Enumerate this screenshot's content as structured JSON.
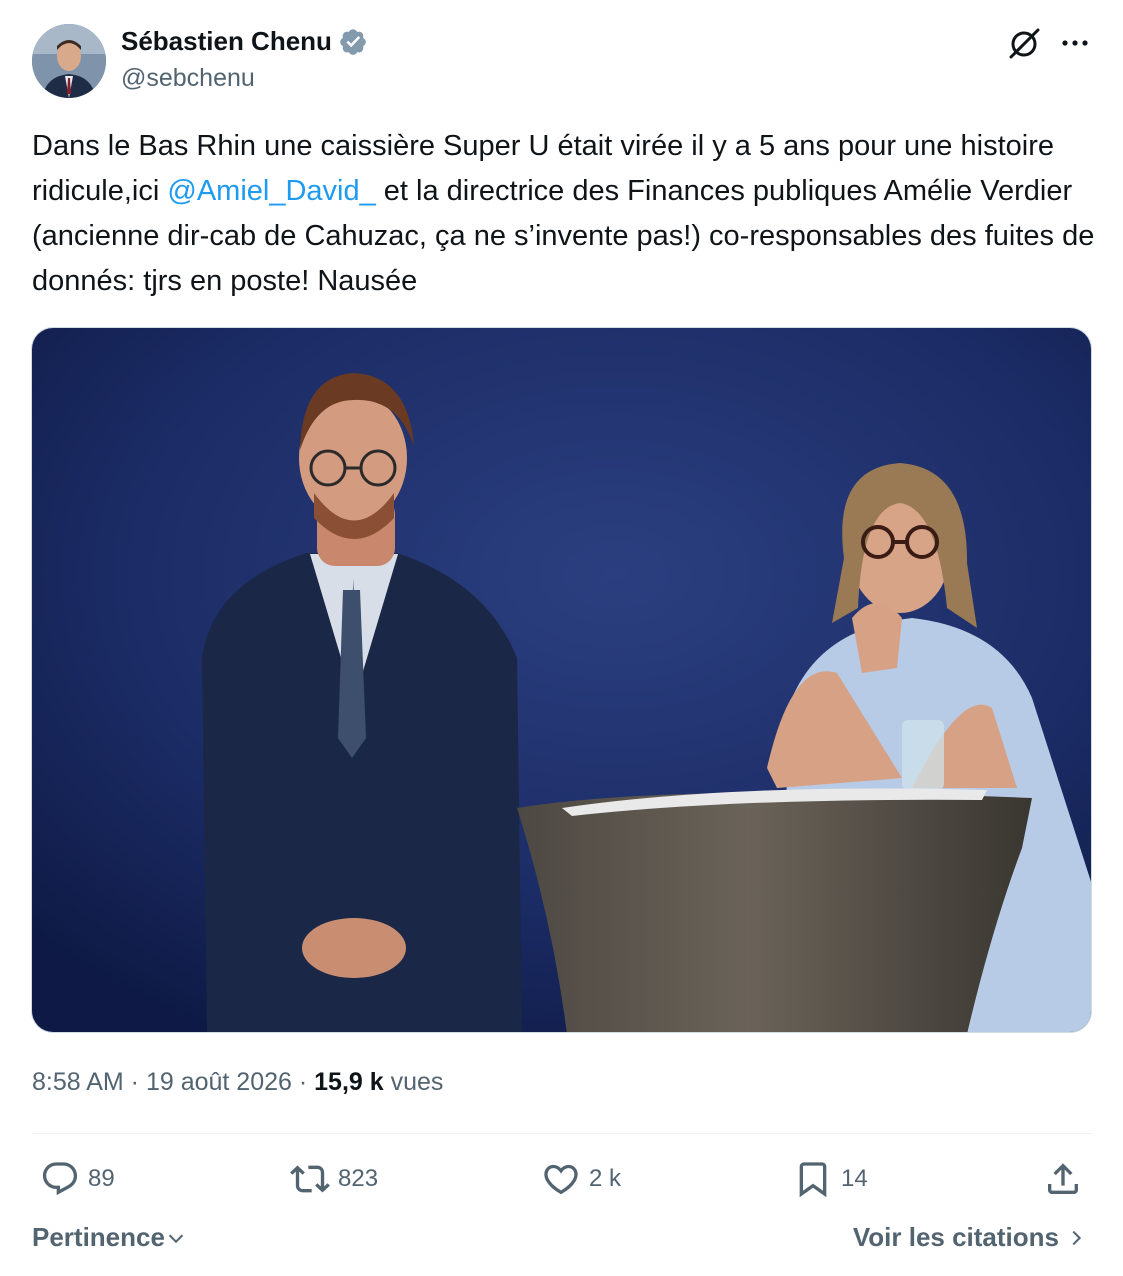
{
  "author": {
    "name": "Sébastien Chenu",
    "handle": "@sebchenu",
    "verified": true
  },
  "icons": {
    "verified": "verified-badge-icon",
    "grok": "grok-icon",
    "more": "more-options-icon",
    "reply": "reply-icon",
    "retweet": "retweet-icon",
    "like": "like-icon",
    "bookmark": "bookmark-icon",
    "share": "share-icon"
  },
  "colors": {
    "accent": "#1d9bf0",
    "secondary_text": "#536471",
    "verified_badge": "#829aab"
  },
  "tweet": {
    "text_part1": "Dans le Bas Rhin une caissière Super U était virée il y a 5 ans pour une histoire ridicule,ici ",
    "mention": "@Amiel_David_",
    "text_part2": " et la directrice des Finances publiques Amélie Verdier (ancienne dir-cab de Cahuzac, ça ne s’invente pas!) co-responsables des fuites de donnés: tjrs en poste! Nausée"
  },
  "meta": {
    "time": "8:58 AM",
    "separator": " · ",
    "date": "19 août 2026",
    "views_count": "15,9 k",
    "views_label": " vues"
  },
  "actions": {
    "replies": "89",
    "retweets": "823",
    "likes": "2 k",
    "bookmarks": "14"
  },
  "footer": {
    "sort_label": "Pertinence",
    "quotes_label": "Voir les citations"
  }
}
